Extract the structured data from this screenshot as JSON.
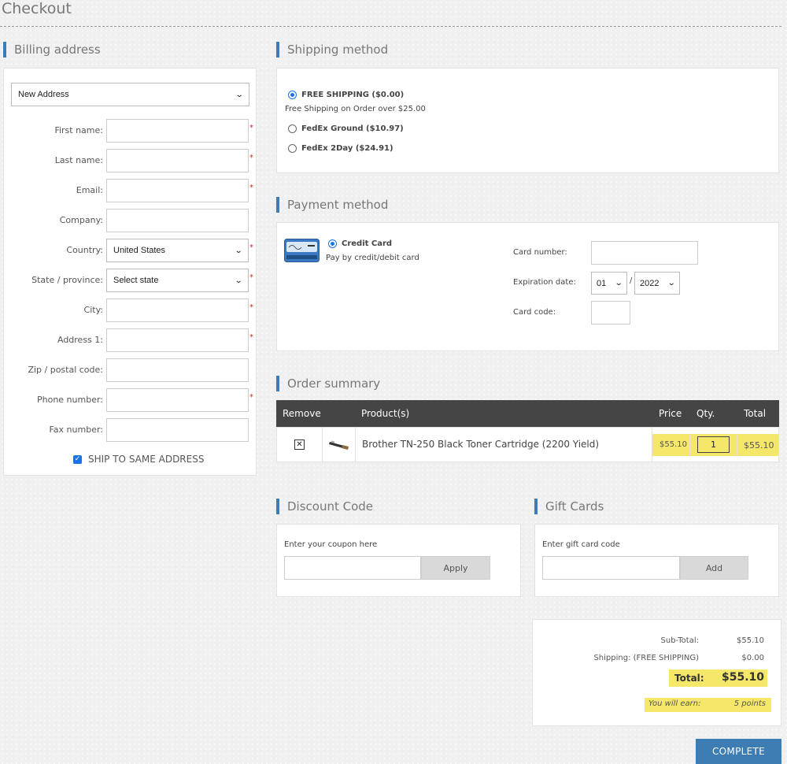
{
  "page": {
    "title": "Checkout"
  },
  "billing": {
    "title": "Billing address",
    "address_select": "New Address",
    "fields": [
      {
        "label": "First name:",
        "value": "",
        "required": true
      },
      {
        "label": "Last name:",
        "value": "",
        "required": true
      },
      {
        "label": "Email:",
        "value": "",
        "required": true
      },
      {
        "label": "Company:",
        "value": "",
        "required": false
      },
      {
        "label": "Country:",
        "value": "United States",
        "required": true,
        "type": "select"
      },
      {
        "label": "State / province:",
        "value": "Select state",
        "required": true,
        "type": "select"
      },
      {
        "label": "City:",
        "value": "",
        "required": true
      },
      {
        "label": "Address 1:",
        "value": "",
        "required": true
      },
      {
        "label": "Zip / postal code:",
        "value": "",
        "required": false
      },
      {
        "label": "Phone number:",
        "value": "",
        "required": true
      },
      {
        "label": "Fax number:",
        "value": "",
        "required": false
      }
    ],
    "ship_same_label": "SHIP TO SAME ADDRESS",
    "ship_same_checked": true
  },
  "shipping": {
    "title": "Shipping method",
    "options": [
      {
        "label": "FREE SHIPPING ($0.00)",
        "selected": true,
        "description": "Free Shipping on Order over $25.00"
      },
      {
        "label": "FedEx Ground ($10.97)",
        "selected": false
      },
      {
        "label": "FedEx 2Day ($24.91)",
        "selected": false
      }
    ]
  },
  "payment": {
    "title": "Payment method",
    "method_label": "Credit Card",
    "method_desc": "Pay by credit/debit card",
    "card_number_label": "Card number:",
    "expiration_label": "Expiration date:",
    "exp_month": "01",
    "exp_separator": "/",
    "exp_year": "2022",
    "card_code_label": "Card code:"
  },
  "order": {
    "title": "Order summary",
    "columns": {
      "remove": "Remove",
      "product": "Product(s)",
      "price": "Price",
      "qty": "Qty.",
      "total": "Total"
    },
    "items": [
      {
        "remove_glyph": "✕",
        "name": "Brother TN-250 Black Toner Cartridge (2200 Yield)",
        "price": "$55.10",
        "qty": "1",
        "total": "$55.10"
      }
    ]
  },
  "discount": {
    "title": "Discount Code",
    "prompt": "Enter your coupon here",
    "button": "Apply"
  },
  "giftcards": {
    "title": "Gift Cards",
    "prompt": "Enter gift card code",
    "button": "Add"
  },
  "totals": {
    "subtotal_label": "Sub-Total:",
    "subtotal_value": "$55.10",
    "shipping_label": "Shipping: (FREE SHIPPING)",
    "shipping_value": "$0.00",
    "total_label": "Total:",
    "total_value": "$55.10",
    "earn_label": "You will earn:",
    "earn_value": "5 points"
  },
  "complete_button": "COMPLETE",
  "colors": {
    "accent": "#3d7db3",
    "highlight": "#f5e76a",
    "table_header": "#454545",
    "required": "#dd2222"
  }
}
